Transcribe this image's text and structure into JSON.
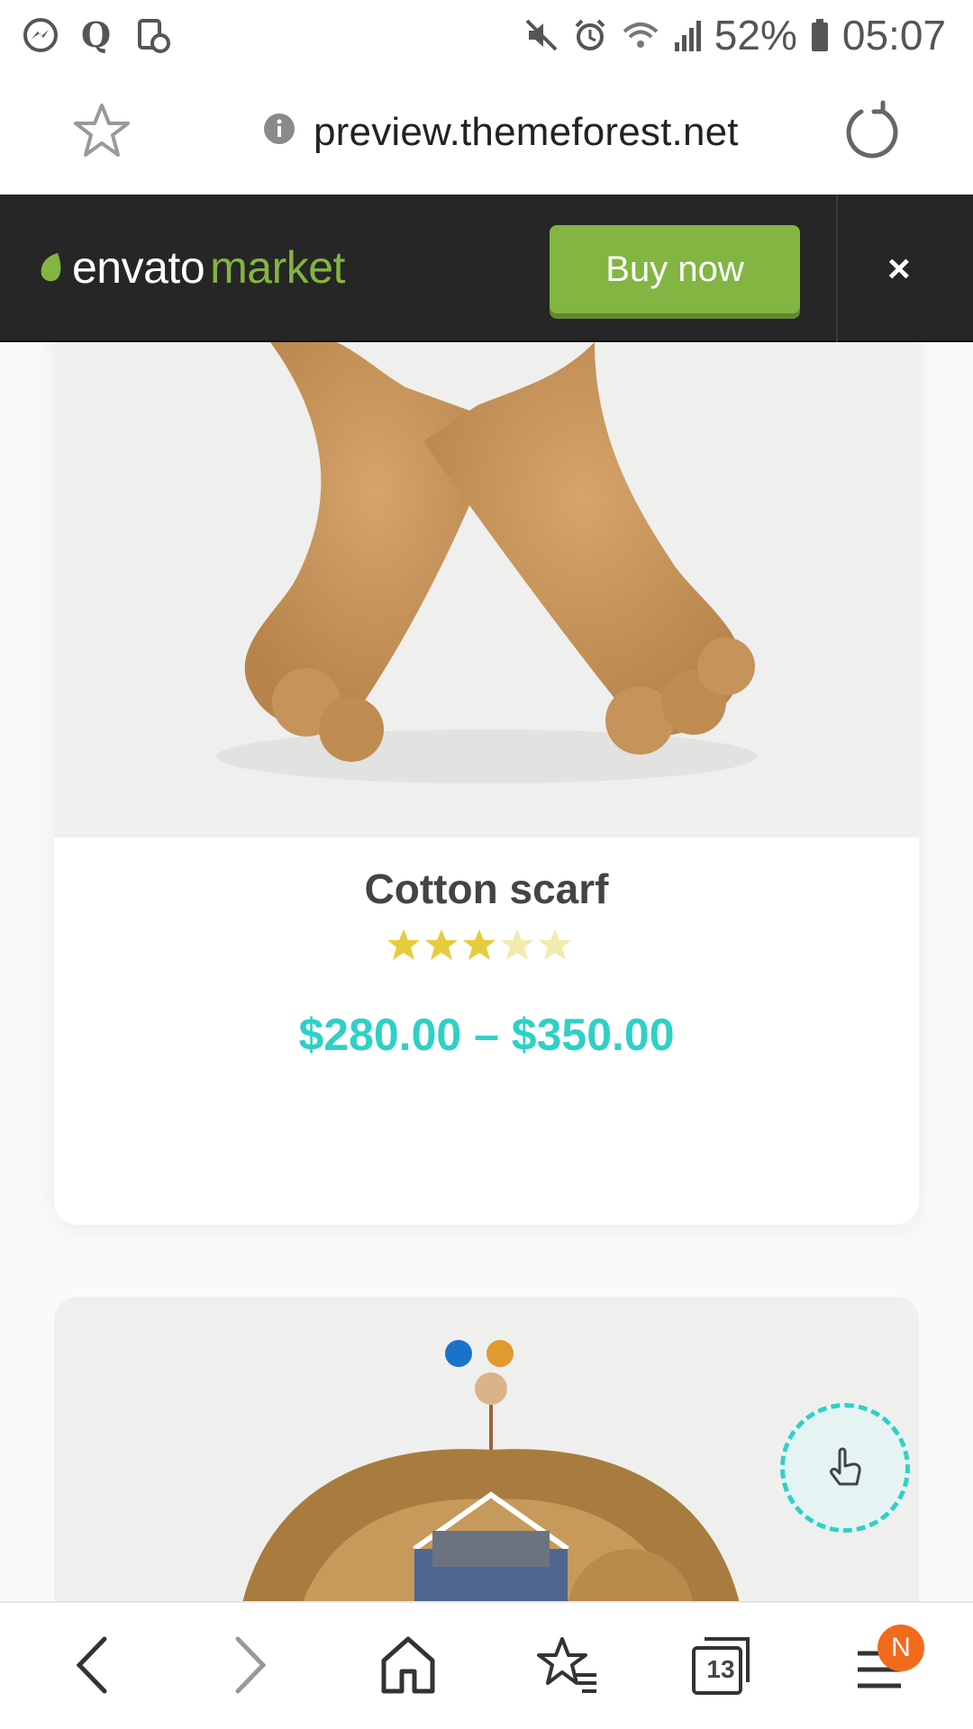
{
  "status_bar": {
    "battery_percent": "52%",
    "time": "05:07",
    "icons": [
      "messenger-icon",
      "q-icon",
      "screen-record-icon",
      "mute-icon",
      "alarm-icon",
      "wifi-icon",
      "signal-icon",
      "battery-icon"
    ]
  },
  "browser": {
    "url": "preview.themeforest.net",
    "icons": [
      "star-icon",
      "info-icon",
      "reload-icon"
    ]
  },
  "envato_bar": {
    "logo_word1": "envato",
    "logo_word2": "market",
    "buy_now_label": "Buy now",
    "close_label": "×",
    "accent_color": "#82b541"
  },
  "product": {
    "title": "Cotton scarf",
    "rating": 3,
    "rating_max": 5,
    "price": "$280.00 – $350.00",
    "price_color": "#2fd0c6"
  },
  "next_product": {
    "color_swatches": [
      "#1a73c8",
      "#e09a30"
    ]
  },
  "bottom_nav": {
    "tab_count": "13",
    "notification_badge": "N",
    "icons": [
      "back-icon",
      "forward-icon",
      "home-icon",
      "bookmarks-icon",
      "tabs-icon",
      "menu-icon"
    ]
  }
}
